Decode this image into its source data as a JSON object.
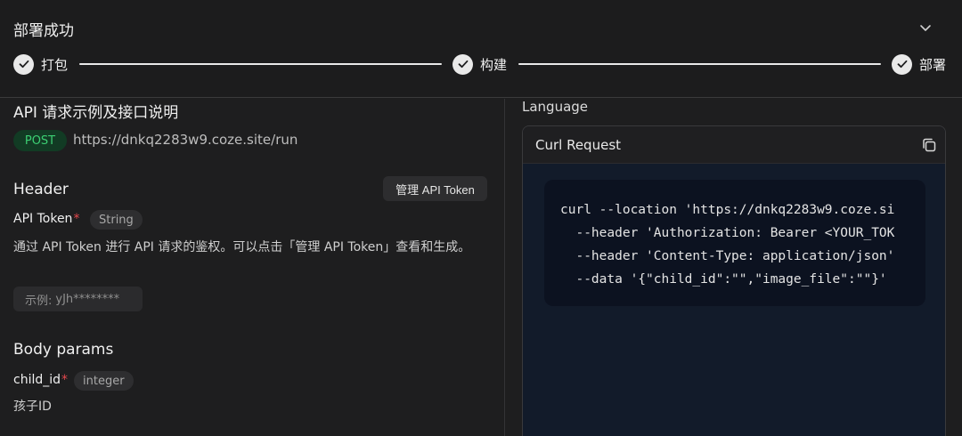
{
  "header": {
    "title": "部署成功",
    "steps": [
      {
        "label": "打包"
      },
      {
        "label": "构建"
      },
      {
        "label": "部署"
      }
    ]
  },
  "api": {
    "title": "API 请求示例及接口说明",
    "method": "POST",
    "url": "https://dnkq2283w9.coze.site/run"
  },
  "header_section": {
    "title": "Header",
    "manage_button": "管理 API Token",
    "param": {
      "name": "API Token",
      "required_mark": "*",
      "type": "String",
      "description": "通过 API Token 进行 API 请求的鉴权。可以点击「管理 API Token」查看和生成。",
      "example_label": "示例:",
      "example_value": "yJh********"
    }
  },
  "body_section": {
    "title": "Body params",
    "param": {
      "name": "child_id",
      "required_mark": "*",
      "type": "integer",
      "description": "孩子ID"
    }
  },
  "code_panel": {
    "language_label": "Language",
    "card_title": "Curl Request",
    "lines": [
      "curl --location 'https://dnkq2283w9.coze.si",
      "  --header 'Authorization: Bearer <YOUR_TOK",
      "  --header 'Content-Type: application/json'",
      "  --data '{\"child_id\":\"\",\"image_file\":\"\"}'"
    ]
  },
  "colors": {
    "accent_success": "#3ccf73",
    "required": "#e5484d",
    "code_bg": "#0c1220"
  }
}
